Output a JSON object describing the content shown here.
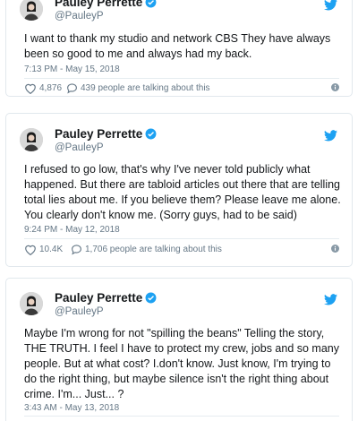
{
  "colors": {
    "verified_blue": "#1da1f2",
    "meta_gray": "#657786",
    "border": "#e1e8ed"
  },
  "tweets": [
    {
      "name": "Pauley Perrette",
      "handle": "@PauleyP",
      "text": "I want to thank my studio and network CBS They have always been so good to me and always had my back.",
      "time": "7:13 PM - May 15, 2018",
      "likes": "4,876",
      "talking": "439 people are talking about this"
    },
    {
      "name": "Pauley Perrette",
      "handle": "@PauleyP",
      "text": "I refused to go low, that's why I've never told publicly what happened. But there are tabloid articles out there that are telling total lies about me. If you believe them? Please leave me alone. You clearly don't know me. (Sorry guys, had to be said)",
      "time": "9:24 PM - May 12, 2018",
      "likes": "10.4K",
      "talking": "1,706 people are talking about this"
    },
    {
      "name": "Pauley Perrette",
      "handle": "@PauleyP",
      "text": "Maybe I'm wrong for not \"spilling the beans\" Telling the story, THE TRUTH. I feel I have to protect my crew, jobs and so many people. But at what cost? I.don't know. Just know, I'm trying to do the right thing, but maybe silence isn't the right thing about crime. I'm... Just... ?",
      "time": "3:43 AM - May 13, 2018"
    }
  ],
  "icons": {
    "verified": "verified-badge-icon",
    "bird": "twitter-bird-icon",
    "heart": "heart-icon",
    "reply": "speech-bubble-icon",
    "info": "info-icon"
  }
}
